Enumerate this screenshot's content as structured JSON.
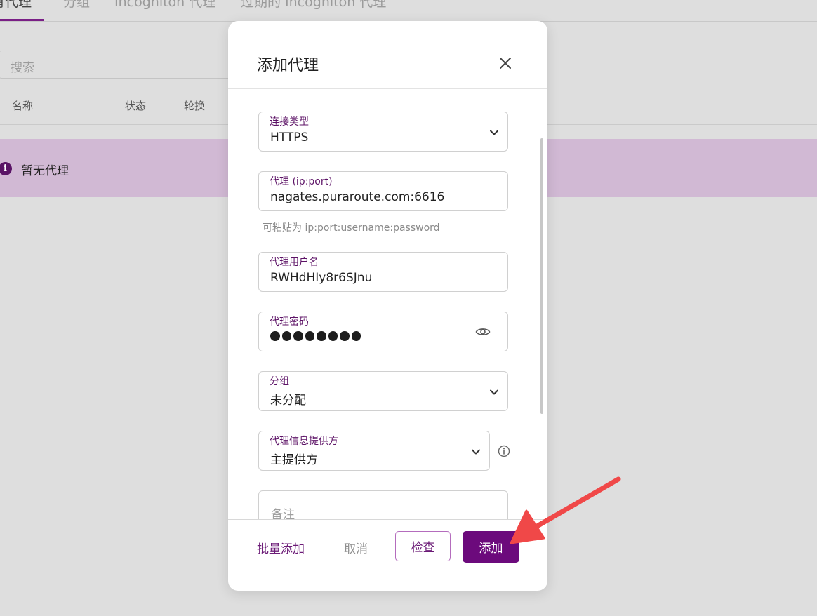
{
  "page": {
    "tabs": [
      {
        "label": "有代理"
      },
      {
        "label": "分组"
      },
      {
        "label": "Incogniton 代理"
      },
      {
        "label": "过期的 Incogniton 代理"
      }
    ],
    "search_placeholder": "搜索",
    "columns": [
      "名称",
      "状态",
      "轮换"
    ],
    "empty_message": "暂无代理",
    "info_glyph": "i"
  },
  "modal": {
    "title": "添加代理",
    "fields": {
      "connection_type": {
        "label": "连接类型",
        "value": "HTTPS"
      },
      "proxy": {
        "label": "代理 (ip:port)",
        "value": "nagates.puraroute.com:6616",
        "hint": "可粘贴为 ip:port:username:password"
      },
      "username": {
        "label": "代理用户名",
        "value": "RWHdHIy8r6SJnu"
      },
      "password": {
        "label": "代理密码",
        "masked_length": 8
      },
      "group": {
        "label": "分组",
        "value": "未分配"
      },
      "provider": {
        "label": "代理信息提供方",
        "value": "主提供方"
      },
      "notes": {
        "placeholder": "备注"
      }
    },
    "buttons": {
      "batch_add": "批量添加",
      "cancel": "取消",
      "check": "检查",
      "add": "添加"
    }
  },
  "colors": {
    "accent": "#6c0a7c",
    "banner": "#d1b9d4",
    "arrow": "#f04848"
  },
  "icons": [
    "close-icon",
    "chevron-down-icon",
    "eye-icon",
    "info-icon",
    "arrow-annotation"
  ]
}
